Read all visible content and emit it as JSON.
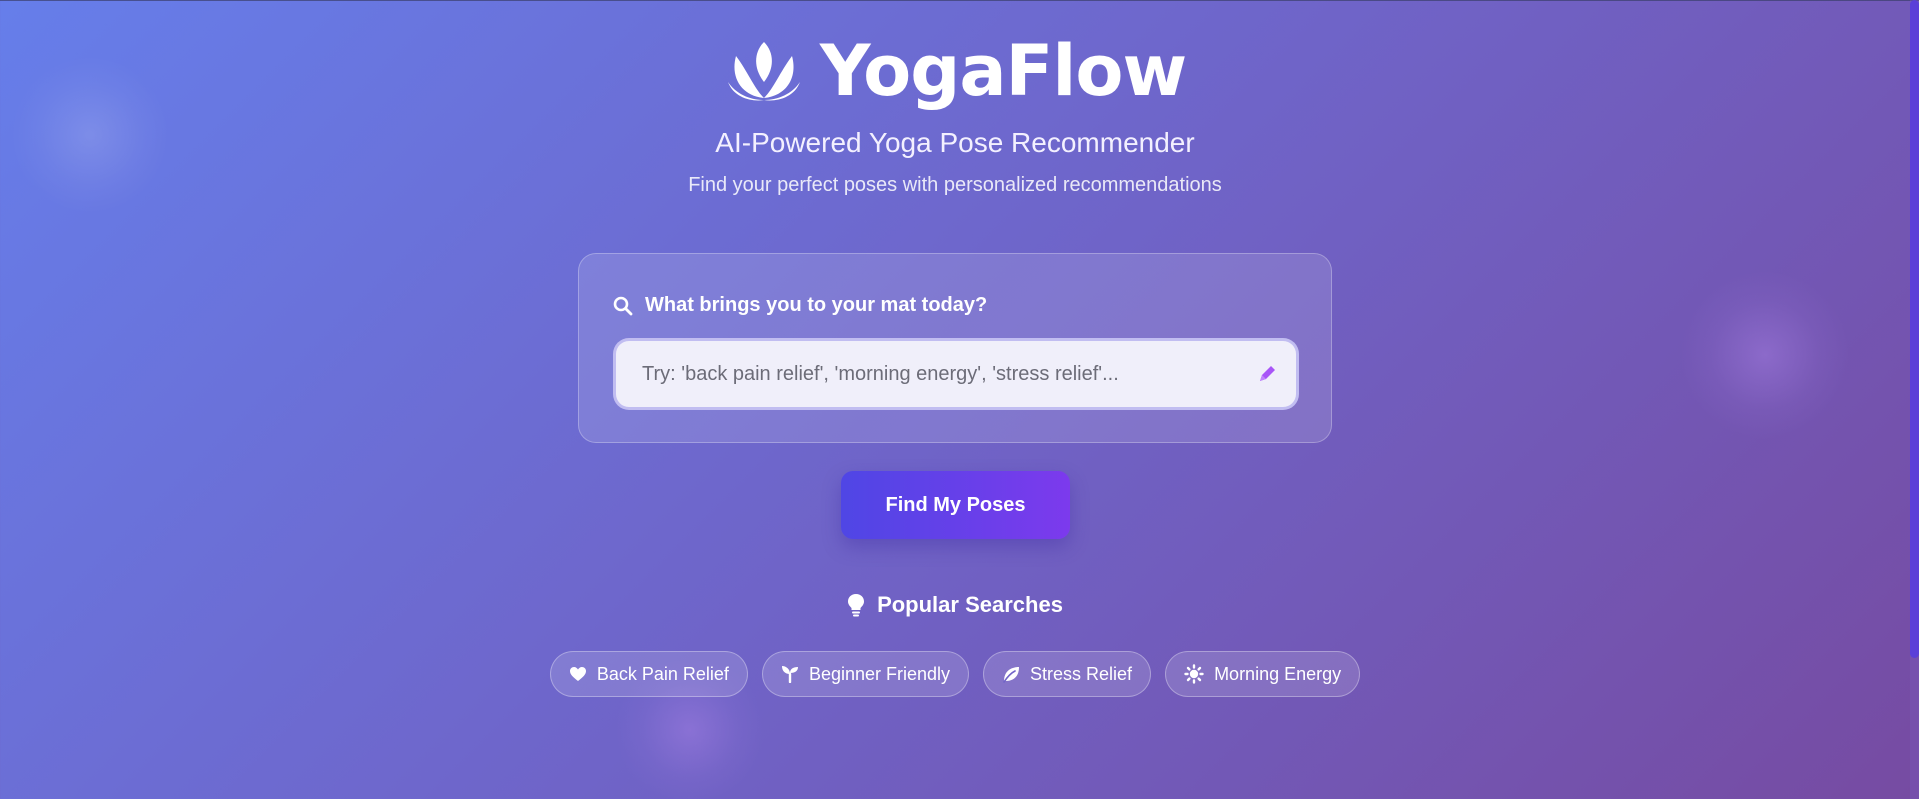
{
  "brand": {
    "name": "YogaFlow",
    "logo_icon": "lotus-icon"
  },
  "header": {
    "subtitle": "AI-Powered Yoga Pose Recommender",
    "tagline": "Find your perfect poses with personalized recommendations"
  },
  "search": {
    "label": "What brings you to your mat today?",
    "label_icon": "search-icon",
    "value": "",
    "placeholder": "Try: 'back pain relief', 'morning energy', 'stress relief'...",
    "trailing_icon": "pencil-icon"
  },
  "actions": {
    "find_label": "Find My Poses"
  },
  "popular": {
    "title": "Popular Searches",
    "title_icon": "lightbulb-icon",
    "chips": [
      {
        "label": "Back Pain Relief",
        "icon": "heart-icon"
      },
      {
        "label": "Beginner Friendly",
        "icon": "seedling-icon"
      },
      {
        "label": "Stress Relief",
        "icon": "leaf-icon"
      },
      {
        "label": "Morning Energy",
        "icon": "sun-icon"
      }
    ]
  },
  "colors": {
    "bg_start": "#667eea",
    "bg_end": "#764ba2",
    "button_start": "#4f46e5",
    "button_end": "#7c3aed",
    "accent_pencil": "#a855f7"
  }
}
